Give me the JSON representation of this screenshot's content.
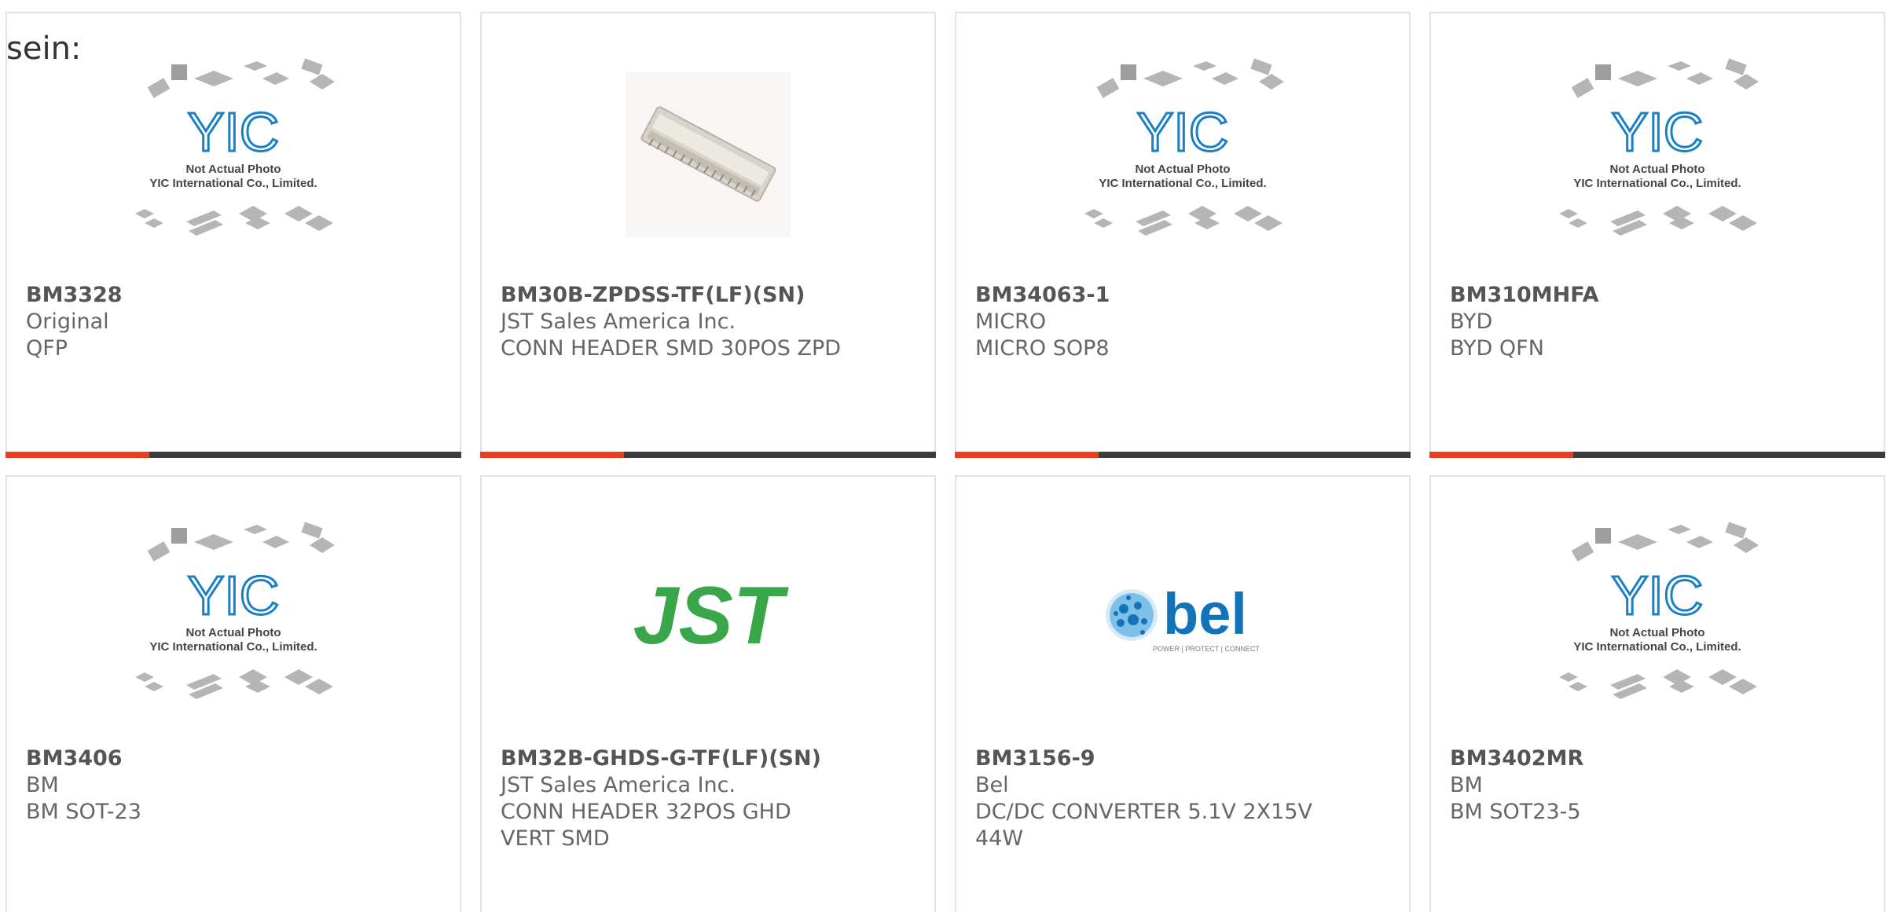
{
  "header_fragment": "sein:",
  "colors": {
    "accent": "#e8401c",
    "bar": "#3c3c3c",
    "border": "#e2e2e2",
    "yic_blue": "#1b7fc4",
    "jst_green": "#3aa64a",
    "bel_blue": "#1273b8"
  },
  "placeholder": {
    "line1": "Not Actual Photo",
    "line2": "YIC International Co., Limited.",
    "logo": "YIC"
  },
  "products": [
    {
      "part": "BM3328",
      "manufacturer": "Original",
      "description": "QFP",
      "image": "yic-placeholder",
      "bar": true
    },
    {
      "part": "BM30B-ZPDSS-TF(LF)(SN)",
      "manufacturer": "JST Sales America Inc.",
      "description": "CONN HEADER SMD 30POS ZPD",
      "image": "connector-photo",
      "bar": true
    },
    {
      "part": "BM34063-1",
      "manufacturer": "MICRO",
      "description": "MICRO SOP8",
      "image": "yic-placeholder",
      "bar": true
    },
    {
      "part": "BM310MHFA",
      "manufacturer": "BYD",
      "description": "BYD QFN",
      "image": "yic-placeholder",
      "bar": true
    },
    {
      "part": "BM3406",
      "manufacturer": "BM",
      "description": "BM SOT-23",
      "image": "yic-placeholder",
      "bar": false
    },
    {
      "part": "BM32B-GHDS-G-TF(LF)(SN)",
      "manufacturer": "JST Sales America Inc.",
      "description": "CONN HEADER 32POS GHD VERT SMD",
      "image": "jst-logo",
      "bar": false
    },
    {
      "part": "BM3156-9",
      "manufacturer": "Bel",
      "description": "DC/DC CONVERTER 5.1V 2X15V 44W",
      "image": "bel-logo",
      "bar": false
    },
    {
      "part": "BM3402MR",
      "manufacturer": "BM",
      "description": "BM SOT23-5",
      "image": "yic-placeholder",
      "bar": false
    }
  ],
  "logos": {
    "jst": "JST",
    "bel": "bel",
    "bel_tagline": "POWER | PROTECT | CONNECT"
  }
}
